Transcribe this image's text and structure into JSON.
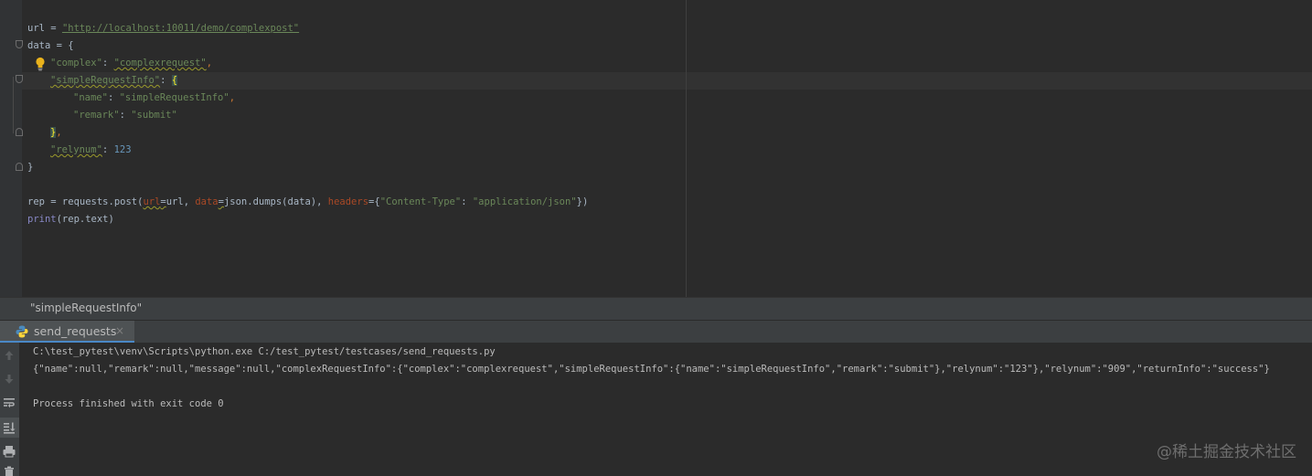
{
  "editor": {
    "line_url": {
      "var": "url",
      "op": " = ",
      "value": "\"http://localhost:10011/demo/complexpost\""
    },
    "line_data": "data = {",
    "line_complex": {
      "key": "\"complex\"",
      "sep": ": ",
      "value": "\"complexrequest\"",
      "end": ","
    },
    "line_simple": {
      "key": "\"simpleRequestInfo\"",
      "sep": ": ",
      "brace": "{"
    },
    "line_name": {
      "key": "\"name\"",
      "sep": ": ",
      "value": "\"simpleRequestInfo\"",
      "end": ","
    },
    "line_remark": {
      "key": "\"remark\"",
      "sep": ": ",
      "value": "\"submit\""
    },
    "line_close_inner": {
      "brace": "}",
      "end": ","
    },
    "line_relynum": {
      "key": "\"relynum\"",
      "sep": ": ",
      "value": "123"
    },
    "line_close_outer": "}",
    "line_post": {
      "prefix": "rep = requests.post(",
      "p_url": "url",
      "eq1": "=",
      "a_url": "url, ",
      "p_data": "data",
      "eq2": "=",
      "a_data": "json.dumps(data), ",
      "p_headers": "headers",
      "eq3": "={",
      "h_key": "\"Content-Type\"",
      "h_sep": ": ",
      "h_val": "\"application/json\"",
      "suffix": "})"
    },
    "line_print": {
      "fn": "print",
      "rest": "(rep.text)"
    }
  },
  "breadcrumb": "\"simpleRequestInfo\"",
  "run": {
    "tab_label": "send_requests",
    "tab_close": "×",
    "console": [
      "C:\\test_pytest\\venv\\Scripts\\python.exe C:/test_pytest/testcases/send_requests.py",
      "{\"name\":null,\"remark\":null,\"message\":null,\"complexRequestInfo\":{\"complex\":\"complexrequest\",\"simpleRequestInfo\":{\"name\":\"simpleRequestInfo\",\"remark\":\"submit\"},\"relynum\":\"123\"},\"relynum\":\"909\",\"returnInfo\":\"success\"}",
      "",
      "Process finished with exit code 0"
    ],
    "toolbar_icons": [
      "up-arrow-icon",
      "down-arrow-icon",
      "soft-wrap-icon",
      "scroll-to-end-icon",
      "print-icon",
      "trash-icon"
    ]
  },
  "watermark": "@稀土掘金技术社区",
  "colors": {
    "keyword": "#cc7832",
    "string": "#6a8759",
    "number": "#6897bb",
    "builtin": "#8888c6",
    "param": "#aa4926",
    "tab_accent": "#4a88c7"
  }
}
